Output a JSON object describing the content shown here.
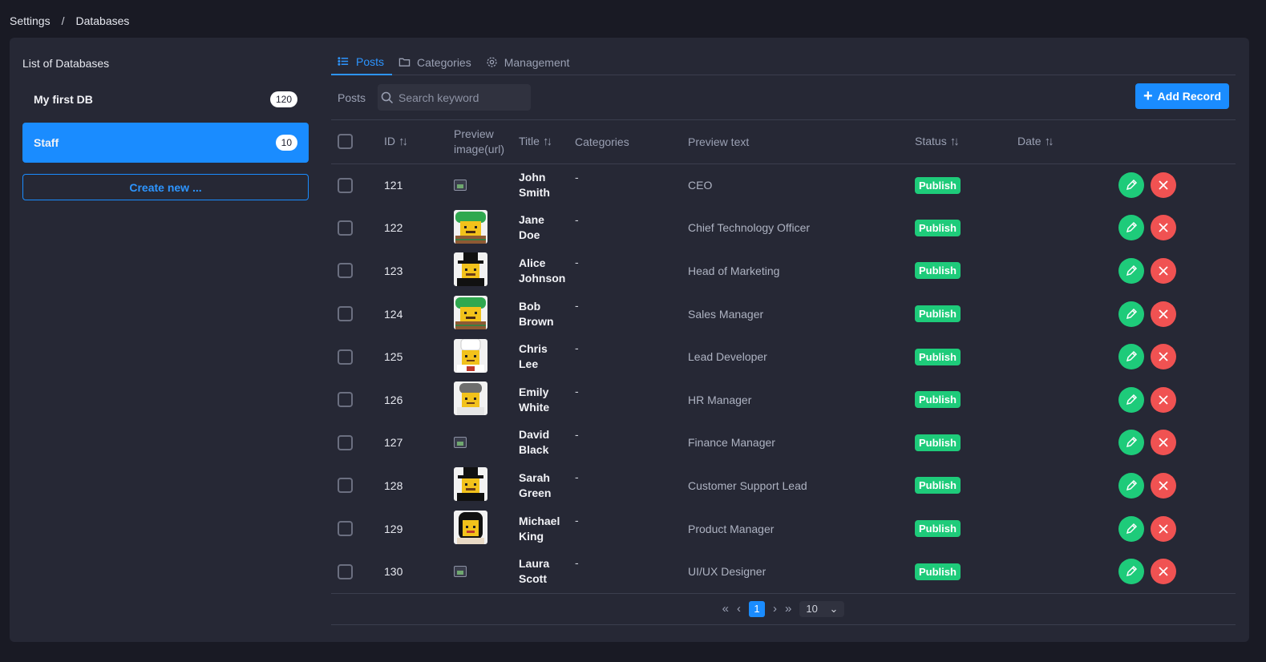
{
  "breadcrumb": {
    "root": "Settings",
    "separator": "/",
    "current": "Databases"
  },
  "sidebar": {
    "title": "List of Databases",
    "databases": [
      {
        "name": "My first DB",
        "count": "120"
      },
      {
        "name": "Staff",
        "count": "10"
      }
    ],
    "create_label": "Create new ..."
  },
  "tabs": [
    {
      "label": "Posts",
      "icon": "list-icon"
    },
    {
      "label": "Categories",
      "icon": "folder-icon"
    },
    {
      "label": "Management",
      "icon": "gear-icon"
    }
  ],
  "toolbar": {
    "label": "Posts",
    "search_placeholder": "Search keyword",
    "add_label": "Add Record"
  },
  "columns": {
    "id": "ID",
    "preview_line1": "Preview",
    "preview_line2": "image(url)",
    "title": "Title",
    "categories": "Categories",
    "preview_text": "Preview text",
    "status": "Status",
    "date": "Date"
  },
  "rows": [
    {
      "id": "121",
      "first": "John",
      "last": "Smith",
      "cat": "-",
      "text": "CEO",
      "status": "Publish",
      "avatar": "broken"
    },
    {
      "id": "122",
      "first": "Jane",
      "last": "Doe",
      "cat": "-",
      "text": "Chief Technology Officer",
      "status": "Publish",
      "avatar": "green-hair"
    },
    {
      "id": "123",
      "first": "Alice",
      "last": "Johnson",
      "cat": "-",
      "text": "Head of Marketing",
      "status": "Publish",
      "avatar": "top-hat"
    },
    {
      "id": "124",
      "first": "Bob",
      "last": "Brown",
      "cat": "-",
      "text": "Sales Manager",
      "status": "Publish",
      "avatar": "green-hair"
    },
    {
      "id": "125",
      "first": "Chris",
      "last": "Lee",
      "cat": "-",
      "text": "Lead Developer",
      "status": "Publish",
      "avatar": "chef"
    },
    {
      "id": "126",
      "first": "Emily",
      "last": "White",
      "cat": "-",
      "text": "HR Manager",
      "status": "Publish",
      "avatar": "grey-cap"
    },
    {
      "id": "127",
      "first": "David",
      "last": "Black",
      "cat": "-",
      "text": "Finance Manager",
      "status": "Publish",
      "avatar": "broken"
    },
    {
      "id": "128",
      "first": "Sarah",
      "last": "Green",
      "cat": "-",
      "text": "Customer Support Lead",
      "status": "Publish",
      "avatar": "top-hat"
    },
    {
      "id": "129",
      "first": "Michael",
      "last": "King",
      "cat": "-",
      "text": "Product Manager",
      "status": "Publish",
      "avatar": "black-hair"
    },
    {
      "id": "130",
      "first": "Laura",
      "last": "Scott",
      "cat": "-",
      "text": "UI/UX Designer",
      "status": "Publish",
      "avatar": "broken"
    }
  ],
  "pagination": {
    "first": "«",
    "prev": "‹",
    "current": "1",
    "next": "›",
    "last": "»",
    "page_size": "10"
  },
  "colors": {
    "accent": "#1a8cff",
    "success": "#1ecb7a",
    "danger": "#f05252",
    "background": "#191a24",
    "panel": "#262835"
  }
}
